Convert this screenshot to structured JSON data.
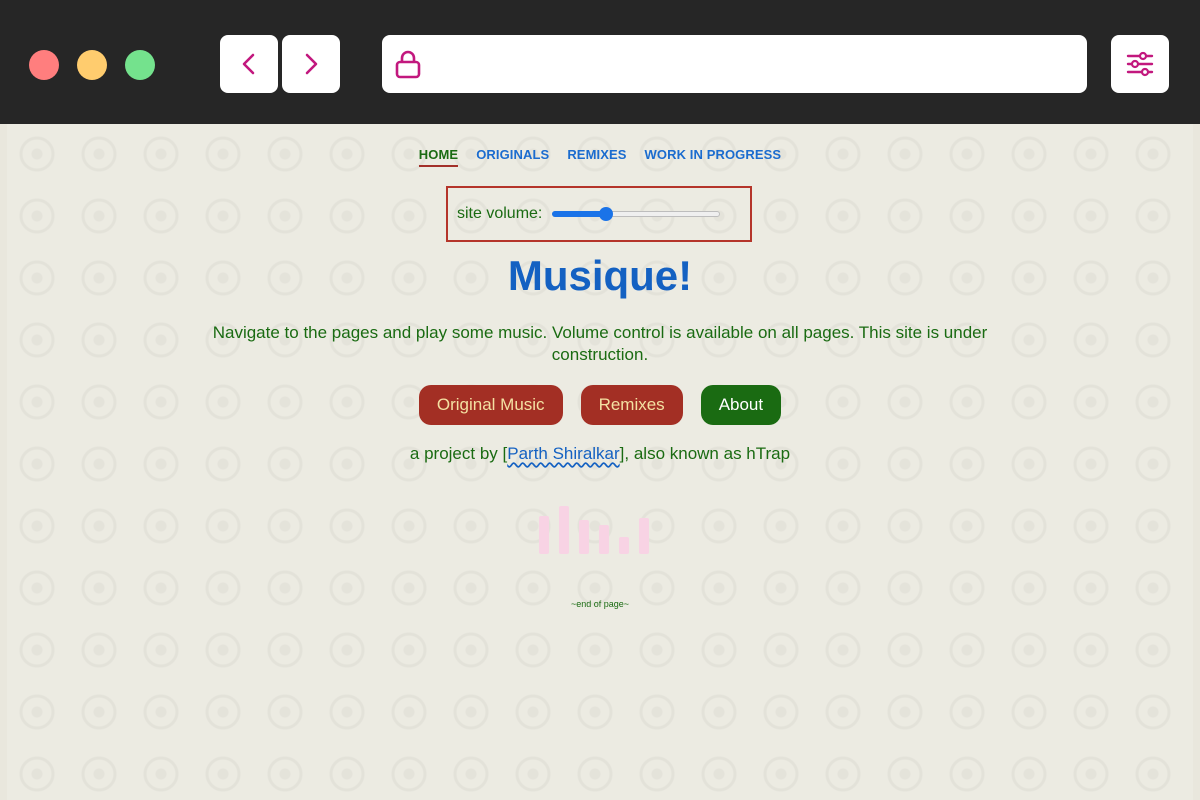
{
  "colors": {
    "chrome": "#262626",
    "dot_red": "#ff7e7e",
    "dot_yellow": "#ffcc6e",
    "dot_green": "#74e28d",
    "icon_accent": "#c2187e",
    "link_blue": "#1b6ccf",
    "text_green": "#1a6b12",
    "button_red": "#a32f24"
  },
  "browser": {
    "back_icon": "chevron-left-icon",
    "forward_icon": "chevron-right-icon",
    "lock_icon": "lock-icon",
    "menu_icon": "sliders-icon"
  },
  "nav": {
    "items": [
      {
        "label": "HOME",
        "active": true
      },
      {
        "label": "ORIGINALS",
        "active": false
      },
      {
        "label": "REMIXES",
        "active": false
      },
      {
        "label": "WORK IN PROGRESS",
        "active": false
      }
    ]
  },
  "volume": {
    "label": "site volume:",
    "value": 0.32
  },
  "hero": {
    "title": "Musique!",
    "intro": "Navigate to the pages and play some music. Volume control is available on all pages. This site is under construction."
  },
  "actions": [
    {
      "label": "Original Music"
    },
    {
      "label": "Remixes"
    },
    {
      "label": "About"
    }
  ],
  "credit": {
    "prefix": "a project by [",
    "author": "Parth Shiralkar",
    "suffix": "], also known as hTrap"
  },
  "visualizer": {
    "levels": [
      0.8,
      1.0,
      0.7,
      0.6,
      0.35,
      0.75
    ]
  },
  "footer": {
    "end_note": "~end of page~"
  }
}
